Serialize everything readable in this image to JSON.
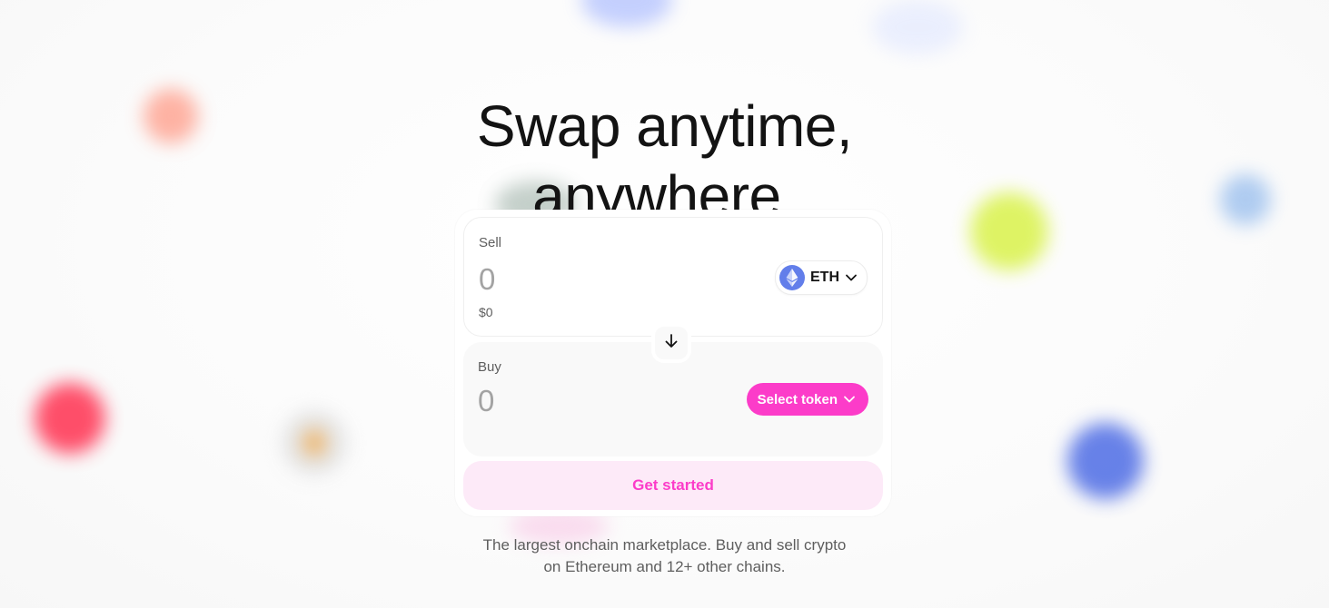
{
  "hero": {
    "headline_line1": "Swap anytime,",
    "headline_line2": "anywhere."
  },
  "swap": {
    "sell": {
      "label": "Sell",
      "amount": "0",
      "usd_value": "$0",
      "token": "ETH",
      "token_icon": "ethereum-icon"
    },
    "flip_icon": "arrow-down-icon",
    "buy": {
      "label": "Buy",
      "amount": "0",
      "select_label": "Select token"
    },
    "cta_label": "Get started"
  },
  "tagline": {
    "line1": "The largest onchain marketplace. Buy and sell crypto",
    "line2": "on Ethereum and 12+ other chains."
  },
  "colors": {
    "accent": "#fc3cc9",
    "accent_soft": "#fdeaf8",
    "eth": "#627eea",
    "text_primary": "#131313",
    "text_secondary": "#5e5e5e",
    "placeholder": "#a3a3a3"
  }
}
